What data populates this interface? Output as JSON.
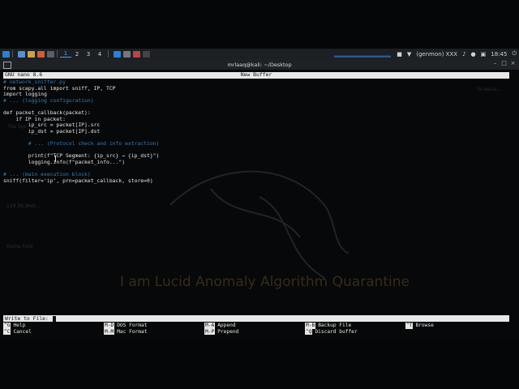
{
  "taskbar": {
    "workspaces": [
      "1",
      "2",
      "3",
      "4"
    ],
    "active_workspace": "1",
    "tray": {
      "weather": "(genmon) XXX",
      "time": "18:45"
    }
  },
  "window": {
    "title": "mrlaaq@kali: ~/Desktop"
  },
  "nano": {
    "version": "GNU nano 8.6",
    "buffer": "New Buffer",
    "lines": [
      {
        "text": "# network_sniffer.py",
        "kind": "comment"
      },
      {
        "text": "from scapy.all import sniff, IP, TCP",
        "kind": "code"
      },
      {
        "text": "import logging",
        "kind": "code"
      },
      {
        "text": "# ... (logging configuration)",
        "kind": "comment"
      },
      {
        "text": "",
        "kind": "code"
      },
      {
        "text": "def packet_callback(packet):",
        "kind": "code"
      },
      {
        "text": "    if IP in packet:",
        "kind": "code"
      },
      {
        "text": "        ip_src = packet[IP].src",
        "kind": "code"
      },
      {
        "text": "        ip_dst = packet[IP].dst",
        "kind": "code"
      },
      {
        "text": "",
        "kind": "code"
      },
      {
        "text": "        # ... (Protocol check and info extraction)",
        "kind": "comment"
      },
      {
        "text": "",
        "kind": "code"
      },
      {
        "text": "        print(f\"TCP Segment: {ip_src} → {ip_dst}\")",
        "kind": "code"
      },
      {
        "text": "        logging.info(f\"packet_info...\")",
        "kind": "code"
      },
      {
        "text": "",
        "kind": "code"
      },
      {
        "text": "# ... (main execution block)",
        "kind": "comment"
      },
      {
        "text": "sniff(filter='ip', prn=packet_callback, store=0)",
        "kind": "code"
      }
    ],
    "prompt": "Write to File: ",
    "shortcuts_row1": [
      {
        "key": "^G",
        "label": "Help"
      },
      {
        "key": "M-D",
        "label": "DOS Format"
      },
      {
        "key": "M-A",
        "label": "Append"
      },
      {
        "key": "M-B",
        "label": "Backup File"
      },
      {
        "key": "^T",
        "label": "Browse"
      }
    ],
    "shortcuts_row2": [
      {
        "key": "^C",
        "label": "Cancel"
      },
      {
        "key": "M-M",
        "label": "Mac Format"
      },
      {
        "key": "M-P",
        "label": "Prepend"
      },
      {
        "key": "^Q",
        "label": "Discard buffer"
      }
    ]
  },
  "wallpaper": {
    "slogan": "I am Lucid Anomaly Algorithm Quarantine"
  },
  "colors": {
    "comment": "#2f7fbd",
    "accent": "#3fa9f5",
    "fg": "#e8e8e8"
  }
}
